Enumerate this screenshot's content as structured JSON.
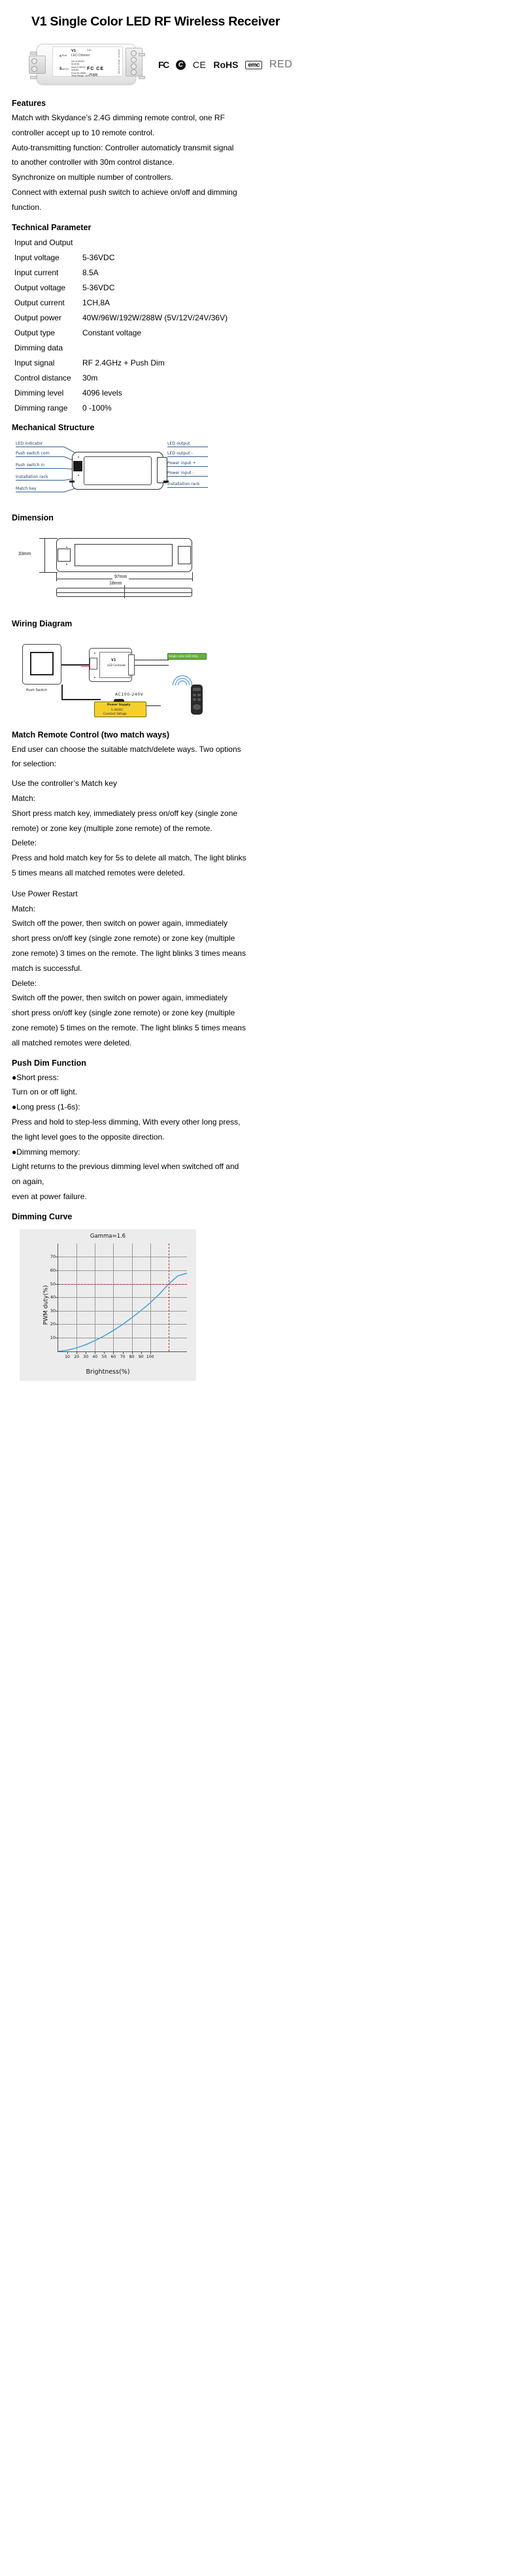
{
  "document": {
    "title": "V1 Single Color LED RF Wireless Receiver"
  },
  "product_image": {
    "model": "V1",
    "subtitle": "LED Dimmer",
    "spec_input": "Uin=5-36VDC\nIin=8.5A",
    "spec_output": "Uout=5-36VDC\nIout=8A\nPout=40-288W\nTemp Range: -30℃~+55℃",
    "cert_fc": "FC",
    "cert_ce": "CE",
    "rohs": "RoHS",
    "band": "2.4G",
    "port_output": "OUTPUT",
    "port_input": "INPUT 5-36VDC",
    "led_run": "RUN",
    "led_match": "MATCH",
    "push_switch": "Push Switch"
  },
  "certifications": [
    {
      "name": "fcc-logo",
      "label": "FC"
    },
    {
      "name": "c-tick-logo",
      "label": "C"
    },
    {
      "name": "ce-logo",
      "label": "CE"
    },
    {
      "name": "rohs-logo",
      "label": "RoHS"
    },
    {
      "name": "emc-logo",
      "label": "emc"
    },
    {
      "name": "red-logo",
      "label": "RED"
    }
  ],
  "features": {
    "heading": "Features",
    "items": [
      "Match with Skydance’s 2.4G dimming remote control, one RF",
      "controller accept up to 10 remote control.",
      "Auto-transmitting function: Controller automaticly transmit signal",
      "to another controller with 30m control distance.",
      "Synchronize on multiple number of controllers.",
      "Connect with external push switch to achieve on/off and dimming",
      "function."
    ]
  },
  "technical_parameter": {
    "heading": "Technical Parameter",
    "group_input_output": "Input and Output",
    "rows_input_output": [
      {
        "label": "Input voltage",
        "value": "5-36VDC"
      },
      {
        "label": "Input current",
        "value": "8.5A"
      },
      {
        "label": "Output voltage",
        "value": "5-36VDC"
      },
      {
        "label": "Output current",
        "value": "1CH,8A"
      },
      {
        "label": "Output power",
        "value": "40W/96W/192W/288W (5V/12V/24V/36V)"
      },
      {
        "label": "Output type",
        "value": "Constant voltage"
      }
    ],
    "group_dimming": "Dimming data",
    "rows_dimming": [
      {
        "label": "Input signal",
        "value": "RF 2.4GHz + Push Dim"
      },
      {
        "label": "Control distance",
        "value": "30m"
      },
      {
        "label": "Dimming level",
        "value": "4096 levels"
      },
      {
        "label": "Dimming range",
        "value": "0 -100%"
      }
    ]
  },
  "mechanical_structure": {
    "heading": "Mechanical Structure",
    "labels_left": [
      "LED indicator",
      "Push switch com",
      "Push switch in",
      "Installation rack",
      "Match key"
    ],
    "labels_right": [
      "LED output",
      "LED output -",
      "Power input +",
      "Power input -",
      "Installation rack"
    ]
  },
  "dimension": {
    "heading": "Dimension",
    "height": "33mm",
    "length": "97mm",
    "depth": "18mm"
  },
  "wiring_diagram": {
    "heading": "Wiring Diagram",
    "push_switch": "Push Switch",
    "mains": "AC100-240V",
    "power_supply_title": "Power Supply",
    "power_supply_spec": "5-36VDC",
    "power_supply_type": "Constant Voltage",
    "controller_model": "V1",
    "controller_sub": "LED Controller",
    "led_strip": "Single color LED strip"
  },
  "match_remote": {
    "heading": "Match Remote Control (two match ways)",
    "intro": [
      "End user can choose the suitable match/delete ways. Two options",
      "for selection:"
    ],
    "way1_title": "Use the controller’s Match key",
    "way1_match_label": "Match:",
    "way1_match_text": [
      "Short press match key,  immediately  press  on/off key (single zone",
      "remote) or zone key (multiple zone remote) of the remote."
    ],
    "way1_delete_label": "Delete:",
    "way1_delete_text": [
      "Press and hold match key for 5s to delete all match, The light blinks",
      "5 times means all matched remotes were deleted."
    ],
    "way2_title": "Use Power Restart",
    "way2_match_label": "Match:",
    "way2_match_text": [
      "Switch off the power, then switch on power again, immediately",
      "short press on/off key (single zone remote) or zone key (multiple",
      "zone remote) 3 times on the remote. The light blinks 3 times means",
      "match is successful."
    ],
    "way2_delete_label": "Delete:",
    "way2_delete_text": [
      "Switch off the power, then switch on power again, immediately",
      "short press on/off key (single zone remote) or zone key (multiple",
      "zone remote) 5 times on the remote. The light blinks 5 times means",
      "all matched remotes were deleted."
    ]
  },
  "push_dim": {
    "heading": "Push Dim Function",
    "items": [
      "●Short press:",
      "Turn on or off light.",
      "●Long press (1-6s):",
      "Press and hold to step-less dimming, With every other long press,",
      "the light level goes to the opposite direction.",
      "●Dimming memory:",
      "Light returns to the previous dimming level when switched off and",
      "on again,",
      "even at power failure."
    ]
  },
  "dimming_curve": {
    "heading": "Dimming Curve"
  },
  "chart_data": {
    "type": "line",
    "title": "Gamma=1.6",
    "xlabel": "Brightness(%)",
    "ylabel": "PWM duty(%)",
    "xlim": [
      0,
      140
    ],
    "ylim": [
      0,
      80
    ],
    "yticks": [
      10,
      20,
      30,
      40,
      50,
      60,
      70
    ],
    "xticks": [
      10,
      20,
      30,
      40,
      50,
      60,
      70,
      80,
      90,
      100
    ],
    "grid": true,
    "legend": "none",
    "annotations": [
      {
        "type": "hline",
        "value": 50,
        "style": "dashed",
        "color": "#b03030"
      },
      {
        "type": "vline",
        "value": 120,
        "style": "dashed",
        "color": "#b03030"
      }
    ],
    "series": [
      {
        "name": "PWM duty",
        "color": "#2e9fd4",
        "x": [
          0,
          10,
          20,
          30,
          40,
          50,
          60,
          70,
          80,
          90,
          100,
          110,
          120,
          130,
          140
        ],
        "y": [
          0,
          0.9,
          2.6,
          5.0,
          8.0,
          11.5,
          15.5,
          20.0,
          25.0,
          30.3,
          36.0,
          42.5,
          50.0,
          56.0,
          58.0
        ]
      }
    ]
  }
}
